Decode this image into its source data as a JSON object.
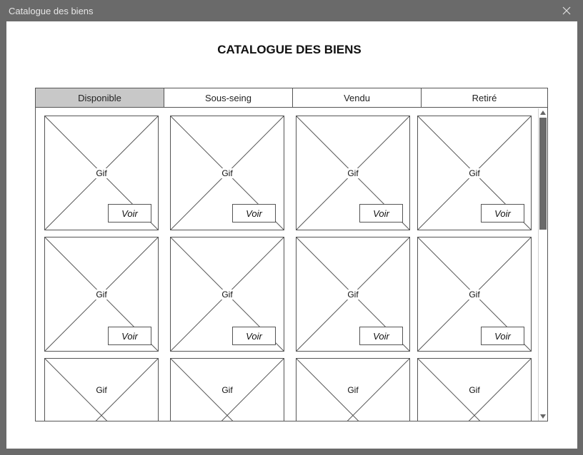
{
  "window": {
    "title": "Catalogue des biens"
  },
  "page": {
    "title": "CATALOGUE DES BIENS"
  },
  "tabs": [
    {
      "label": "Disponible",
      "active": true
    },
    {
      "label": "Sous-seing",
      "active": false
    },
    {
      "label": "Vendu",
      "active": false
    },
    {
      "label": "Retiré",
      "active": false
    }
  ],
  "cards": {
    "image_label": "Gif",
    "button_label": "Voir"
  },
  "scroll": {
    "thumb_fraction": 0.38
  }
}
